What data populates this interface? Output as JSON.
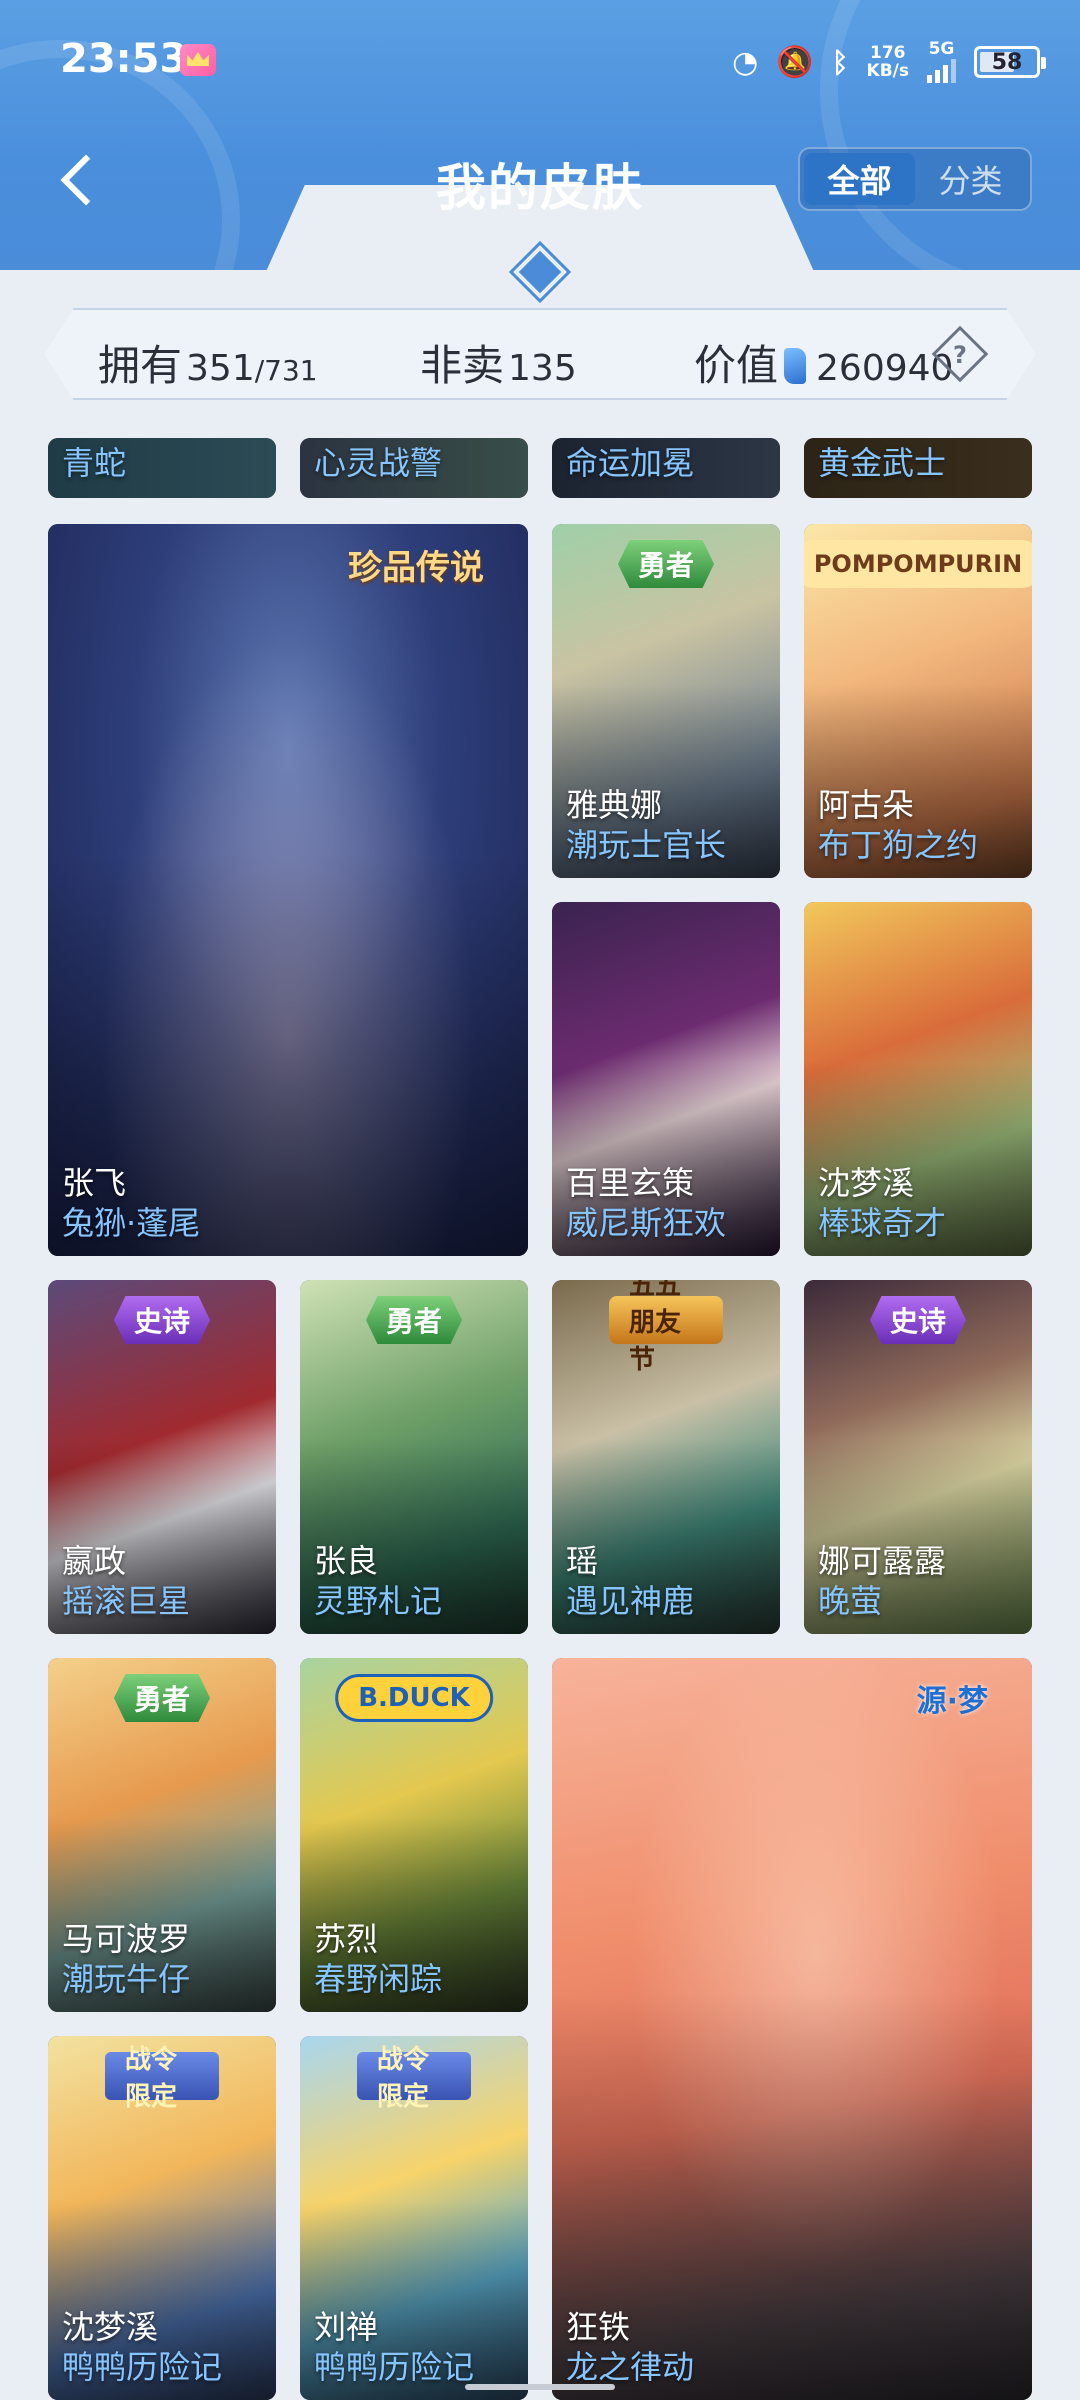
{
  "status_bar": {
    "time": "23:53",
    "speed_value": "176",
    "speed_unit": "KB/s",
    "network": "5G",
    "battery": "58"
  },
  "header": {
    "title": "我的皮肤",
    "tabs": [
      {
        "label": "全部",
        "active": true
      },
      {
        "label": "分类",
        "active": false
      }
    ]
  },
  "stats": {
    "owned_label": "拥有",
    "owned_value": "351",
    "owned_total": "/731",
    "unsold_label": "非卖",
    "unsold_value": "135",
    "value_label": "价值",
    "value_amount": "260940",
    "help": "?"
  },
  "skins": [
    {
      "hero": "",
      "skin": "青蛇",
      "tag": ""
    },
    {
      "hero": "",
      "skin": "心灵战警",
      "tag": ""
    },
    {
      "hero": "",
      "skin": "命运加冕",
      "tag": ""
    },
    {
      "hero": "",
      "skin": "黄金武士",
      "tag": ""
    },
    {
      "hero": "张飞",
      "skin": "兔狲·蓬尾",
      "tag": "珍品传说"
    },
    {
      "hero": "雅典娜",
      "skin": "潮玩士官长",
      "tag": "勇者"
    },
    {
      "hero": "阿古朵",
      "skin": "布丁狗之约",
      "tag": "POMPOMPURIN"
    },
    {
      "hero": "百里玄策",
      "skin": "威尼斯狂欢",
      "tag": ""
    },
    {
      "hero": "沈梦溪",
      "skin": "棒球奇才",
      "tag": ""
    },
    {
      "hero": "嬴政",
      "skin": "摇滚巨星",
      "tag": "史诗"
    },
    {
      "hero": "张良",
      "skin": "灵野札记",
      "tag": "勇者"
    },
    {
      "hero": "瑶",
      "skin": "遇见神鹿",
      "tag": "五五朋友节"
    },
    {
      "hero": "娜可露露",
      "skin": "晚萤",
      "tag": "史诗"
    },
    {
      "hero": "马可波罗",
      "skin": "潮玩牛仔",
      "tag": "勇者"
    },
    {
      "hero": "苏烈",
      "skin": "春野闲踪",
      "tag": "B.DUCK"
    },
    {
      "hero": "狂铁",
      "skin": "龙之律动",
      "tag": "源·梦"
    },
    {
      "hero": "沈梦溪",
      "skin": "鸭鸭历险记",
      "tag": "战令限定"
    },
    {
      "hero": "刘禅",
      "skin": "鸭鸭历险记",
      "tag": "战令限定"
    }
  ]
}
